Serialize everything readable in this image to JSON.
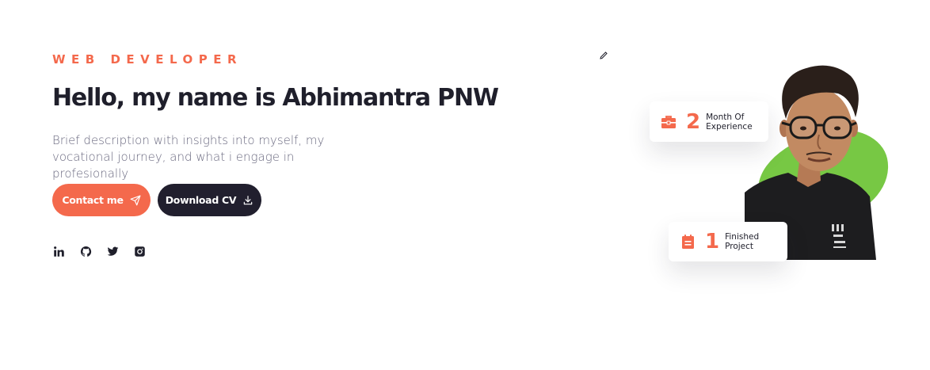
{
  "hero": {
    "eyebrow": "WEB DEVELOPER",
    "headline": "Hello, my name is Abhimantra PNW",
    "description": "Brief description with insights into myself, my vocational journey, and what i engage in profesionally",
    "contact_label": "Contact me",
    "download_label": "Download CV"
  },
  "socials": [
    {
      "icon": "linkedin-icon"
    },
    {
      "icon": "github-icon"
    },
    {
      "icon": "twitter-icon"
    },
    {
      "icon": "instagram-icon"
    }
  ],
  "stats": {
    "experience": {
      "number": "2",
      "line1": "Month Of",
      "line2": "Experience",
      "icon": "briefcase-icon"
    },
    "projects": {
      "number": "1",
      "line1": "Finished",
      "line2": "Project",
      "icon": "clipboard-icon"
    }
  },
  "colors": {
    "accent": "#f4694c",
    "dark": "#211f2e",
    "blob": "#77c844",
    "muted_text": "#6b6a80"
  }
}
